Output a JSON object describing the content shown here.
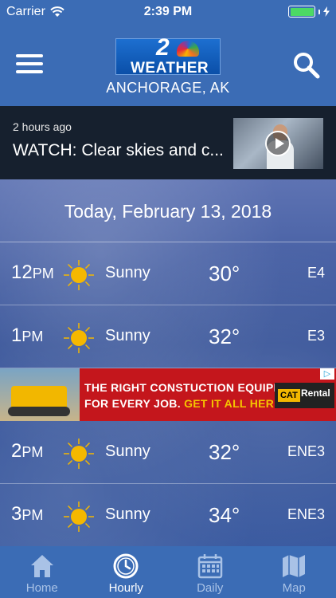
{
  "status": {
    "carrier": "Carrier",
    "time": "2:39 PM"
  },
  "header": {
    "logo_number": "2",
    "logo_text": "WEATHER",
    "location": "ANCHORAGE, AK"
  },
  "news": {
    "time": "2 hours ago",
    "title": "WATCH: Clear skies and c..."
  },
  "date_label": "Today, February 13, 2018",
  "hours": [
    {
      "hour": "12",
      "ampm": "PM",
      "icon": "sun-icon",
      "condition": "Sunny",
      "temp": "30°",
      "wind": "E4"
    },
    {
      "hour": "1",
      "ampm": "PM",
      "icon": "sun-icon",
      "condition": "Sunny",
      "temp": "32°",
      "wind": "E3"
    },
    {
      "hour": "2",
      "ampm": "PM",
      "icon": "sun-icon",
      "condition": "Sunny",
      "temp": "32°",
      "wind": "ENE3"
    },
    {
      "hour": "3",
      "ampm": "PM",
      "icon": "sun-icon",
      "condition": "Sunny",
      "temp": "34°",
      "wind": "ENE3"
    }
  ],
  "ad": {
    "line1": "THE RIGHT  CONSTUCTION EQUIPMENT",
    "line2_start": "FOR EVERY JOB. ",
    "line2_emph": "GET IT ALL HERE.",
    "brand": "CAT",
    "brand_sub": "Rental"
  },
  "tabs": [
    {
      "label": "Home",
      "icon": "home-icon"
    },
    {
      "label": "Hourly",
      "icon": "clock-icon"
    },
    {
      "label": "Daily",
      "icon": "calendar-icon"
    },
    {
      "label": "Map",
      "icon": "map-icon"
    }
  ],
  "colors": {
    "header": "#3b6cb5",
    "news_bg": "#16202e",
    "sun": "#f5b800",
    "ad_red": "#c4161c"
  }
}
